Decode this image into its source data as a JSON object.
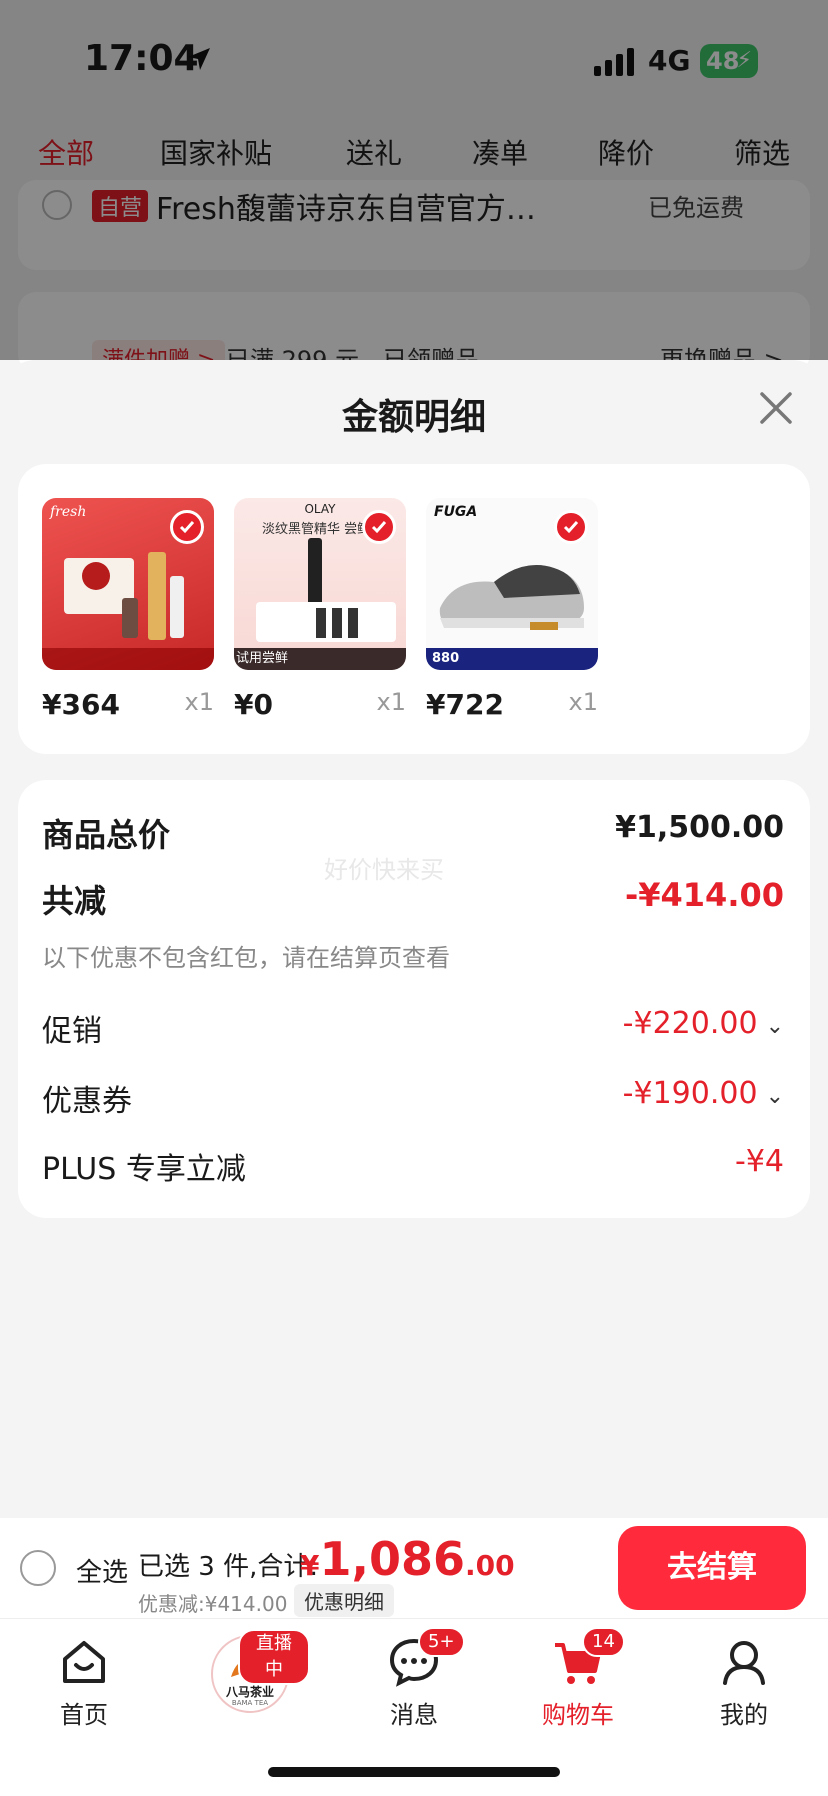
{
  "status_bar": {
    "time": "17:04",
    "network": "4G",
    "battery": "48"
  },
  "top_tabs": [
    "全部",
    "国家补贴",
    "送礼",
    "凑单",
    "降价",
    "筛选"
  ],
  "background": {
    "self_badge": "自营",
    "shop_name": "Fresh馥蕾诗京东自营官方…",
    "shipping": "已免运费",
    "promo_tag": "满件加赠 >",
    "promo_text": "已满 299 元，已领赠品",
    "swap": "更换赠品 >"
  },
  "sheet": {
    "title": "金额明细",
    "items": [
      {
        "price": "¥364",
        "qty": "x1",
        "brand": "fresh",
        "tone": "red"
      },
      {
        "price": "¥0",
        "qty": "x1",
        "brand": "OLAY",
        "tone": "pink",
        "caption": "淡纹黑管精华 尝鲜",
        "tag": "试用尝鲜"
      },
      {
        "price": "¥722",
        "qty": "x1",
        "brand": "FUGA",
        "tone": "white",
        "caption": "880"
      }
    ],
    "summary": {
      "total_label": "商品总价",
      "total_value": "¥1,500.00",
      "watermark": "好价快来买",
      "reduce_label": "共减",
      "reduce_value": "-¥414.00",
      "note": "以下优惠不包含红包，请在结算页查看",
      "promo_label": "促销",
      "promo_value": "-¥220.00",
      "coupon_label": "优惠券",
      "coupon_value": "-¥190.00",
      "plus_label": "PLUS 专享立减",
      "plus_value": "-¥4"
    }
  },
  "checkout": {
    "select_all": "全选",
    "selected": "已选 3 件,合计:",
    "currency": "¥",
    "total_int": "1,086",
    "total_dec": ".00",
    "discount": "优惠减:¥414.00",
    "detail": "优惠明细",
    "button": "去结算"
  },
  "tabbar": {
    "home": "首页",
    "live_badge": "直播中",
    "live_brand": "八马茶业",
    "live_sub": "BAMA TEA",
    "messages": "消息",
    "messages_badge": "5+",
    "cart": "购物车",
    "cart_badge": "14",
    "me": "我的"
  },
  "colors": {
    "accent": "#e4202a",
    "button": "#ff2b3d",
    "background": "#f4f4f4"
  }
}
